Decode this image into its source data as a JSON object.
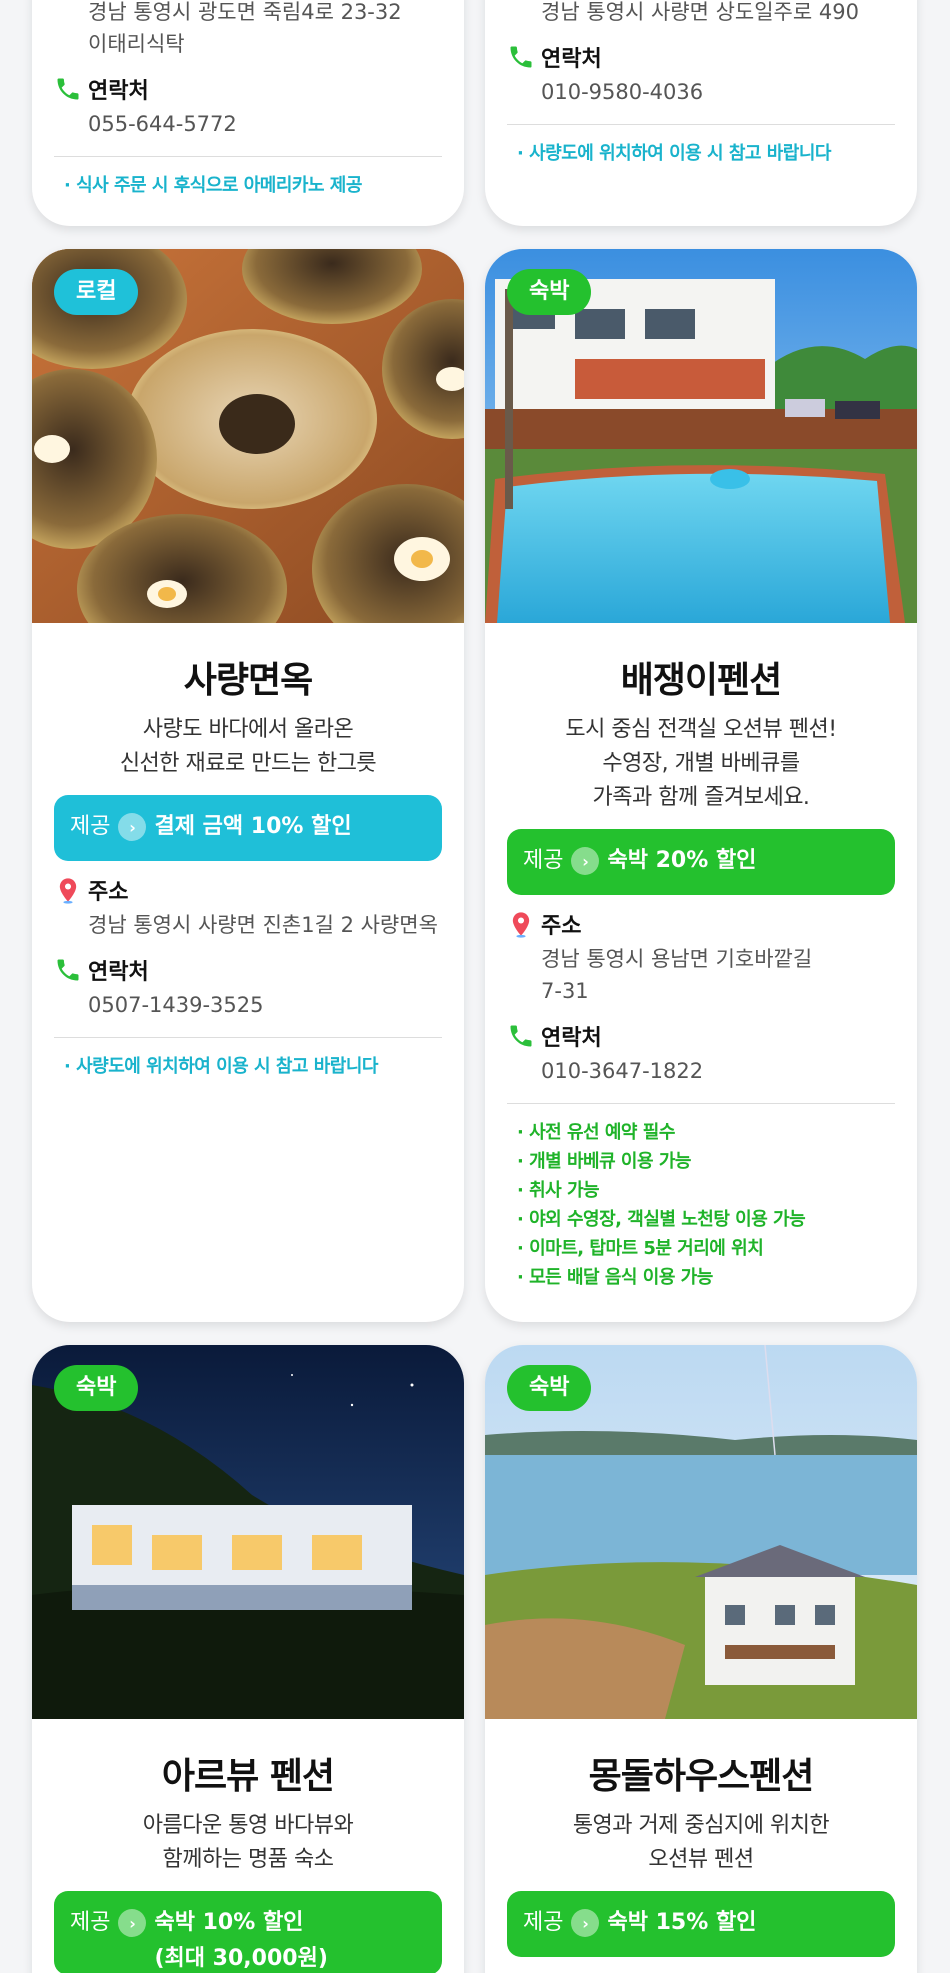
{
  "top_cards": {
    "left": {
      "address_partial": "경남 통영시 광도면 죽림4로 23-32\n이태리식탁",
      "contact_label": "연락처",
      "contact_value": "055-644-5772",
      "notes": [
        "· 식사 주문 시 후식으로 아메리카노 제공"
      ]
    },
    "right": {
      "address_partial": "경남 통영시 사량면 상도일주로 490",
      "contact_label": "연락처",
      "contact_value": "010-9580-4036",
      "notes": [
        "· 사량도에 위치하여 이용 시 참고 바랍니다"
      ]
    }
  },
  "cards": [
    {
      "badge": "로컬",
      "badge_color": "#1fc1d9",
      "title": "사량면옥",
      "desc": "사량도 바다에서 올라온\n신선한 재료로 만드는 한그릇",
      "offer_provide": "제공",
      "offer_benefit": "결제 금액 10% 할인",
      "address_label": "주소",
      "address": "경남 통영시 사량면 진촌1길 2 사량면옥",
      "contact_label": "연락처",
      "contact": "0507-1439-3525",
      "notes": [
        "· 사량도에 위치하여 이용 시 참고 바랍니다"
      ]
    },
    {
      "badge": "숙박",
      "badge_color": "#24c12e",
      "title": "배쟁이펜션",
      "desc": "도시 중심 전객실 오션뷰 펜션!\n수영장, 개별 바베큐를\n가족과 함께 즐겨보세요.",
      "offer_provide": "제공",
      "offer_benefit": "숙박 20% 할인",
      "address_label": "주소",
      "address": "경남 통영시 용남면 기호바깥길\n7-31",
      "contact_label": "연락처",
      "contact": "010-3647-1822",
      "notes": [
        "· 사전 유선 예약 필수",
        "· 개별 바베큐 이용 가능",
        "· 취사 가능",
        "· 야외 수영장, 객실별 노천탕 이용 가능",
        "· 이마트, 탑마트 5분 거리에 위치",
        "· 모든 배달 음식 이용 가능"
      ]
    },
    {
      "badge": "숙박",
      "badge_color": "#24c12e",
      "title": "아르뷰 펜션",
      "desc": "아름다운 통영 바다뷰와\n함께하는 명품 숙소",
      "offer_provide": "제공",
      "offer_benefit": "숙박 10% 할인\n(최대 30,000원)"
    },
    {
      "badge": "숙박",
      "badge_color": "#24c12e",
      "title": "몽돌하우스펜션",
      "desc": "통영과 거제 중심지에 위치한\n오션뷰 펜션",
      "offer_provide": "제공",
      "offer_benefit": "숙박 15% 할인"
    }
  ]
}
